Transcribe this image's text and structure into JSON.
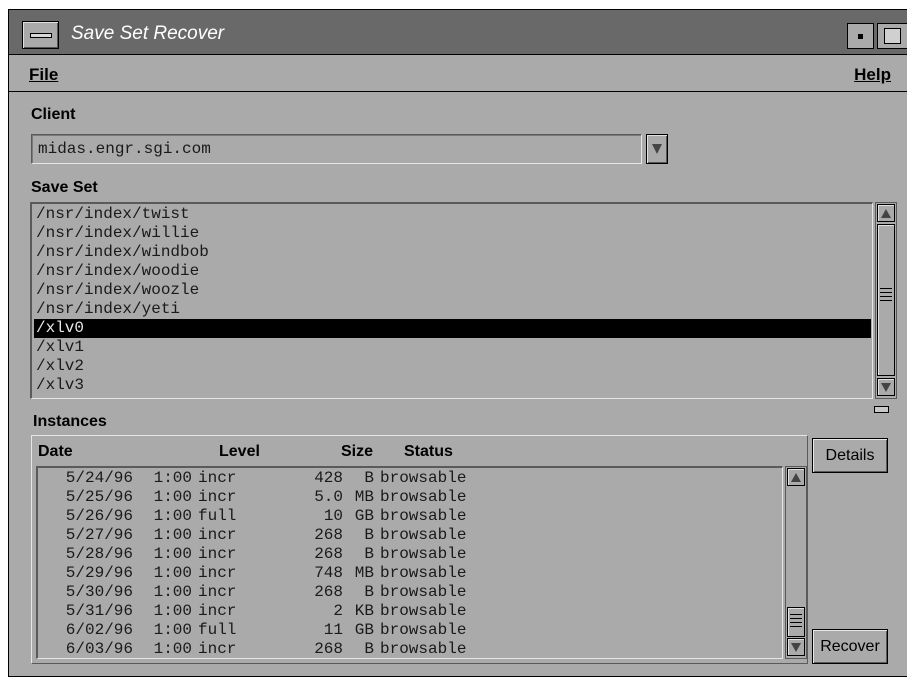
{
  "window": {
    "title": "Save Set Recover"
  },
  "menubar": {
    "file": "File",
    "help": "Help"
  },
  "client": {
    "label": "Client",
    "value": "midas.engr.sgi.com"
  },
  "saveset": {
    "label": "Save Set",
    "items": [
      "/nsr/index/twist",
      "/nsr/index/willie",
      "/nsr/index/windbob",
      "/nsr/index/woodie",
      "/nsr/index/woozle",
      "/nsr/index/yeti",
      "/xlv0",
      "/xlv1",
      "/xlv2",
      "/xlv3"
    ],
    "selected": "/xlv0"
  },
  "instances": {
    "label": "Instances",
    "columns": {
      "date": "Date",
      "level": "Level",
      "size": "Size",
      "status": "Status"
    },
    "rows": [
      {
        "date": "5/24/96",
        "time": "1:00",
        "level": "incr",
        "size": "428",
        "unit": "B",
        "status": "browsable"
      },
      {
        "date": "5/25/96",
        "time": "1:00",
        "level": "incr",
        "size": "5.0",
        "unit": "MB",
        "status": "browsable"
      },
      {
        "date": "5/26/96",
        "time": "1:00",
        "level": "full",
        "size": "10",
        "unit": "GB",
        "status": "browsable"
      },
      {
        "date": "5/27/96",
        "time": "1:00",
        "level": "incr",
        "size": "268",
        "unit": "B",
        "status": "browsable"
      },
      {
        "date": "5/28/96",
        "time": "1:00",
        "level": "incr",
        "size": "268",
        "unit": "B",
        "status": "browsable"
      },
      {
        "date": "5/29/96",
        "time": "1:00",
        "level": "incr",
        "size": "748",
        "unit": "MB",
        "status": "browsable"
      },
      {
        "date": "5/30/96",
        "time": "1:00",
        "level": "incr",
        "size": "268",
        "unit": "B",
        "status": "browsable"
      },
      {
        "date": "5/31/96",
        "time": "1:00",
        "level": "incr",
        "size": "2",
        "unit": "KB",
        "status": "browsable"
      },
      {
        "date": "6/02/96",
        "time": "1:00",
        "level": "full",
        "size": "11",
        "unit": "GB",
        "status": "browsable"
      },
      {
        "date": "6/03/96",
        "time": "1:00",
        "level": "incr",
        "size": "268",
        "unit": "B",
        "status": "browsable"
      }
    ]
  },
  "buttons": {
    "details": "Details",
    "recover": "Recover"
  },
  "icons": {
    "window_menu": "window-menu-icon",
    "minimize": "minimize-icon",
    "maximize": "maximize-icon",
    "dropdown": "dropdown-arrow-icon",
    "scroll_up": "scroll-up-icon",
    "scroll_down": "scroll-down-icon"
  },
  "colors": {
    "background": "#aaaaaa",
    "titlebar": "#696969",
    "selection": "#000000"
  }
}
